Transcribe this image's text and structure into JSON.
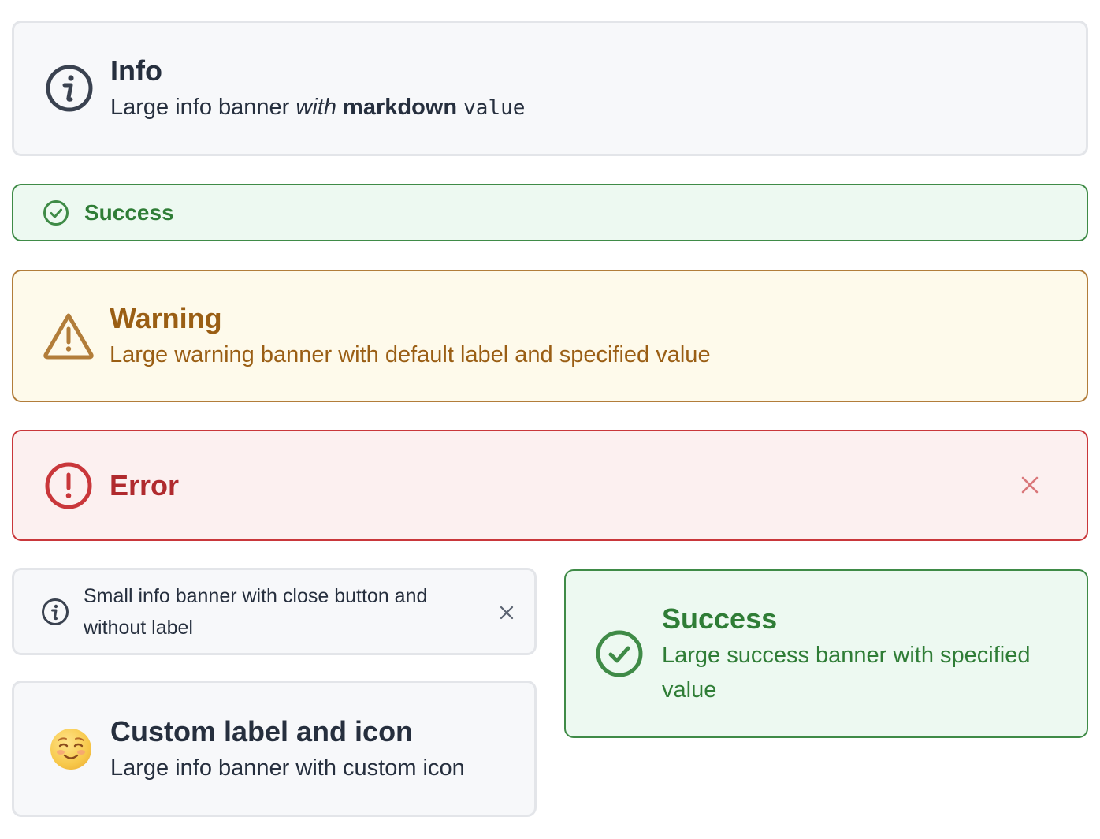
{
  "colors": {
    "info_bg": "#f7f8fa",
    "info_text": "#262f3e",
    "success_bg": "#edf9f1",
    "success_text": "#2f7d36",
    "warning_bg": "#fefaeb",
    "warning_text": "#9a5e14",
    "error_bg": "#fcf0f0",
    "error_text": "#b02a2e"
  },
  "info_banner": {
    "icon": "info-circle-icon",
    "label": "Info",
    "value_prefix": "Large info banner ",
    "value_italic": "with",
    "value_bold": "markdown",
    "value_code": "value"
  },
  "success_small": {
    "icon": "check-circle-icon",
    "label": "Success"
  },
  "warning_banner": {
    "icon": "warning-triangle-icon",
    "label": "Warning",
    "value": "Large warning banner with default label and specified value"
  },
  "error_banner": {
    "icon": "error-circle-icon",
    "label": "Error",
    "close_icon": "close-icon"
  },
  "info_small": {
    "icon": "info-circle-icon",
    "value": "Small info banner with close button and without label",
    "close_icon": "close-icon"
  },
  "success_large": {
    "icon": "check-circle-icon",
    "label": "Success",
    "value": "Large success banner with specified value"
  },
  "custom_banner": {
    "icon": "smiling-face-emoji-icon",
    "label": "Custom label and icon",
    "value": "Large info banner with custom icon"
  }
}
